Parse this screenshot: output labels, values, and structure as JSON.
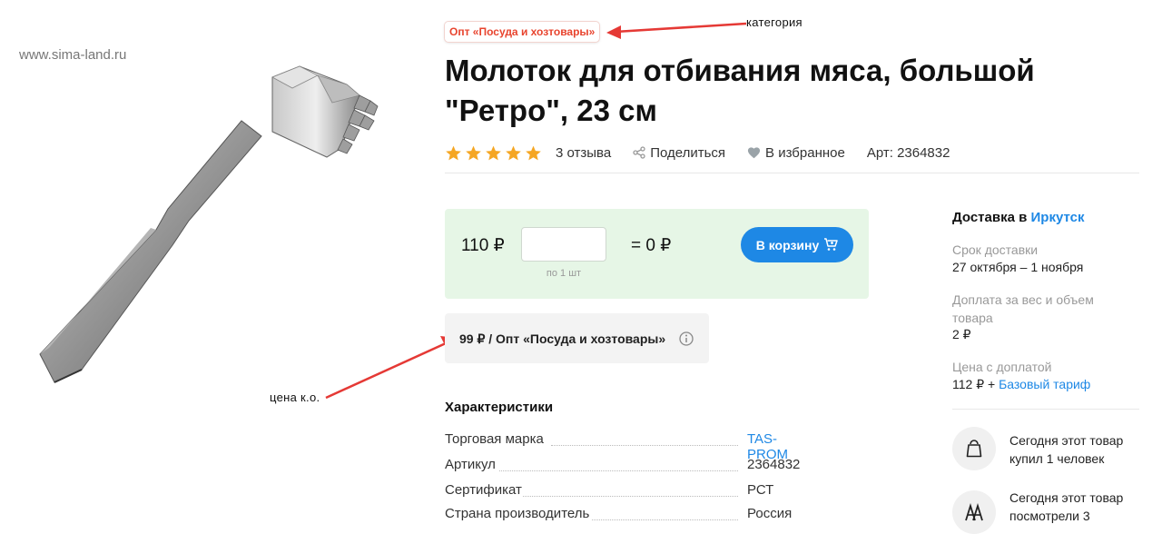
{
  "watermark": "www.sima-land.ru",
  "category": "Опт «Посуда и хозтовары»",
  "annotations": {
    "category": "категория",
    "wholesale_price": "цена к.о."
  },
  "product": {
    "title": "Молоток для отбивания мяса, большой \"Ретро\", 23 см",
    "rating": 5,
    "reviews": "3 отзыва",
    "share": "Поделиться",
    "favorite": "В избранное",
    "article": "Арт: 2364832"
  },
  "buy": {
    "price": "110 ₽",
    "quantity_value": "",
    "quantity_hint": "по 1 шт",
    "total": "= 0 ₽",
    "cart_button": "В корзину"
  },
  "wholesale": {
    "text": "99 ₽ / Опт «Посуда и хозтовары»"
  },
  "characteristics": {
    "title": "Характеристики",
    "rows": [
      {
        "label": "Торговая марка",
        "value": "TAS-PROM"
      },
      {
        "label": "Артикул",
        "value": "2364832"
      },
      {
        "label": "Сертификат",
        "value": "РСТ"
      },
      {
        "label": "Страна производитель",
        "value": "Россия"
      }
    ]
  },
  "delivery": {
    "title_prefix": "Доставка в",
    "city": "Иркутск",
    "term_label": "Срок доставки",
    "term_value": "27 октября – 1 ноября",
    "surcharge_label": "Доплата за вес и объем товара",
    "surcharge_value": "2 ₽",
    "price_label": "Цена с доплатой",
    "price_value": "112 ₽ +",
    "tariff_link": "Базовый тариф"
  },
  "stats": [
    {
      "icon": "shopping-bag-icon",
      "text": "Сегодня этот товар купил 1 человек"
    },
    {
      "icon": "people-icon",
      "text": "Сегодня этот товар посмотрели 3"
    }
  ],
  "colors": {
    "accent": "#1e88e5",
    "star": "#f5a623",
    "buy_box": "#e6f6e6",
    "annotation_arrow": "#e53935",
    "category_text": "#e8442e"
  }
}
